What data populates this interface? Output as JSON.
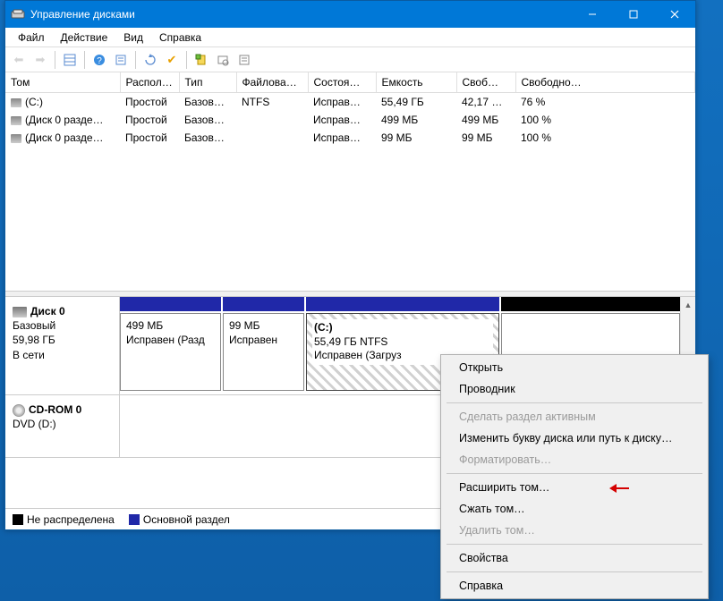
{
  "window": {
    "title": "Управление дисками"
  },
  "menubar": [
    "Файл",
    "Действие",
    "Вид",
    "Справка"
  ],
  "table": {
    "headers": [
      "Том",
      "Распол…",
      "Тип",
      "Файлова…",
      "Состоя…",
      "Емкость",
      "Своб…",
      "Свободно…"
    ],
    "rows": [
      {
        "vol": "(C:)",
        "layout": "Простой",
        "type": "Базов…",
        "fs": "NTFS",
        "status": "Исправ…",
        "cap": "55,49 ГБ",
        "free": "42,17 …",
        "freepct": "76 %"
      },
      {
        "vol": "(Диск 0 разде…",
        "layout": "Простой",
        "type": "Базов…",
        "fs": "",
        "status": "Исправ…",
        "cap": "499 МБ",
        "free": "499 МБ",
        "freepct": "100 %"
      },
      {
        "vol": "(Диск 0 разде…",
        "layout": "Простой",
        "type": "Базов…",
        "fs": "",
        "status": "Исправ…",
        "cap": "99 МБ",
        "free": "99 МБ",
        "freepct": "100 %"
      }
    ]
  },
  "disks": {
    "disk0": {
      "name": "Диск 0",
      "kind": "Базовый",
      "size": "59,98 ГБ",
      "state": "В сети",
      "parts": [
        {
          "title": "",
          "line1": "499 МБ",
          "line2": "Исправен (Разд"
        },
        {
          "title": "",
          "line1": "99 МБ",
          "line2": "Исправен"
        },
        {
          "title": "(C:)",
          "line1": "55,49 ГБ NTFS",
          "line2": "Исправен (Загруз"
        }
      ]
    },
    "cdrom": {
      "name": "CD-ROM 0",
      "line2": "DVD (D:)"
    }
  },
  "legend": {
    "unalloc": "Не распределена",
    "primary": "Основной раздел"
  },
  "ctx": {
    "open": "Открыть",
    "explorer": "Проводник",
    "active": "Сделать раздел активным",
    "letter": "Изменить букву диска или путь к диску…",
    "format": "Форматировать…",
    "extend": "Расширить том…",
    "shrink": "Сжать том…",
    "delete": "Удалить том…",
    "props": "Свойства",
    "help": "Справка"
  }
}
